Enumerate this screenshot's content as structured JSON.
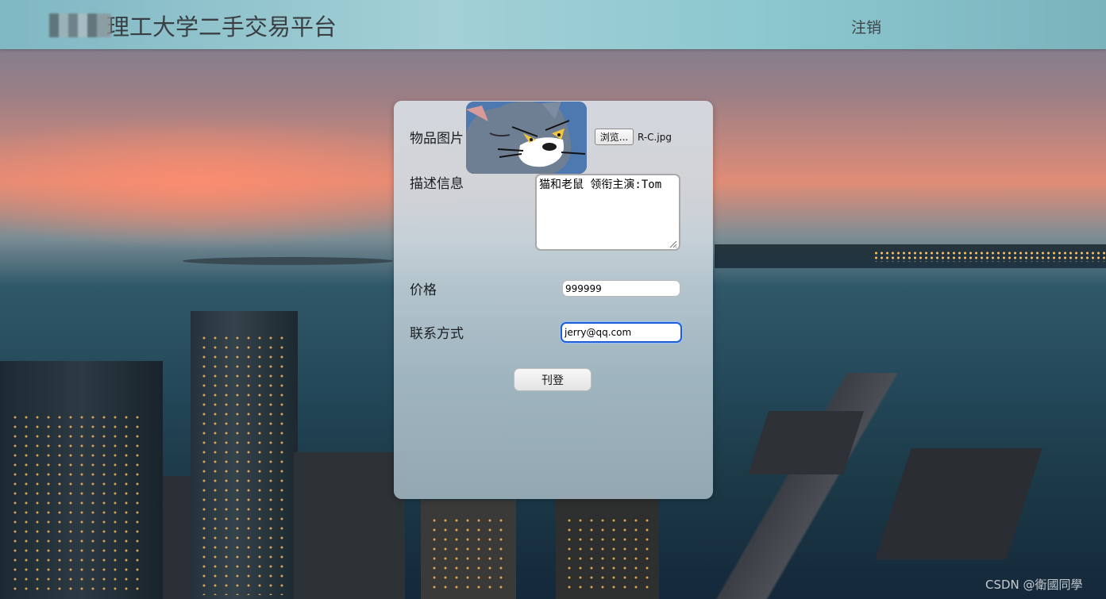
{
  "header": {
    "title": "理工大学二手交易平台",
    "logout_label": "注销"
  },
  "form": {
    "photo_label": "物品图片",
    "browse_label": "浏览...",
    "file_name": "R-C.jpg",
    "description_label": "描述信息",
    "description_value": "猫和老鼠   领衔主演:Tom",
    "price_label": "价格",
    "price_value": "999999",
    "contact_label": "联系方式",
    "contact_value": "jerry@qq.com",
    "submit_label": "刊登"
  },
  "watermark": "CSDN @衛國同學",
  "colors": {
    "header_bg": "#a3d0d6",
    "focus_ring": "#1e5ed6"
  }
}
